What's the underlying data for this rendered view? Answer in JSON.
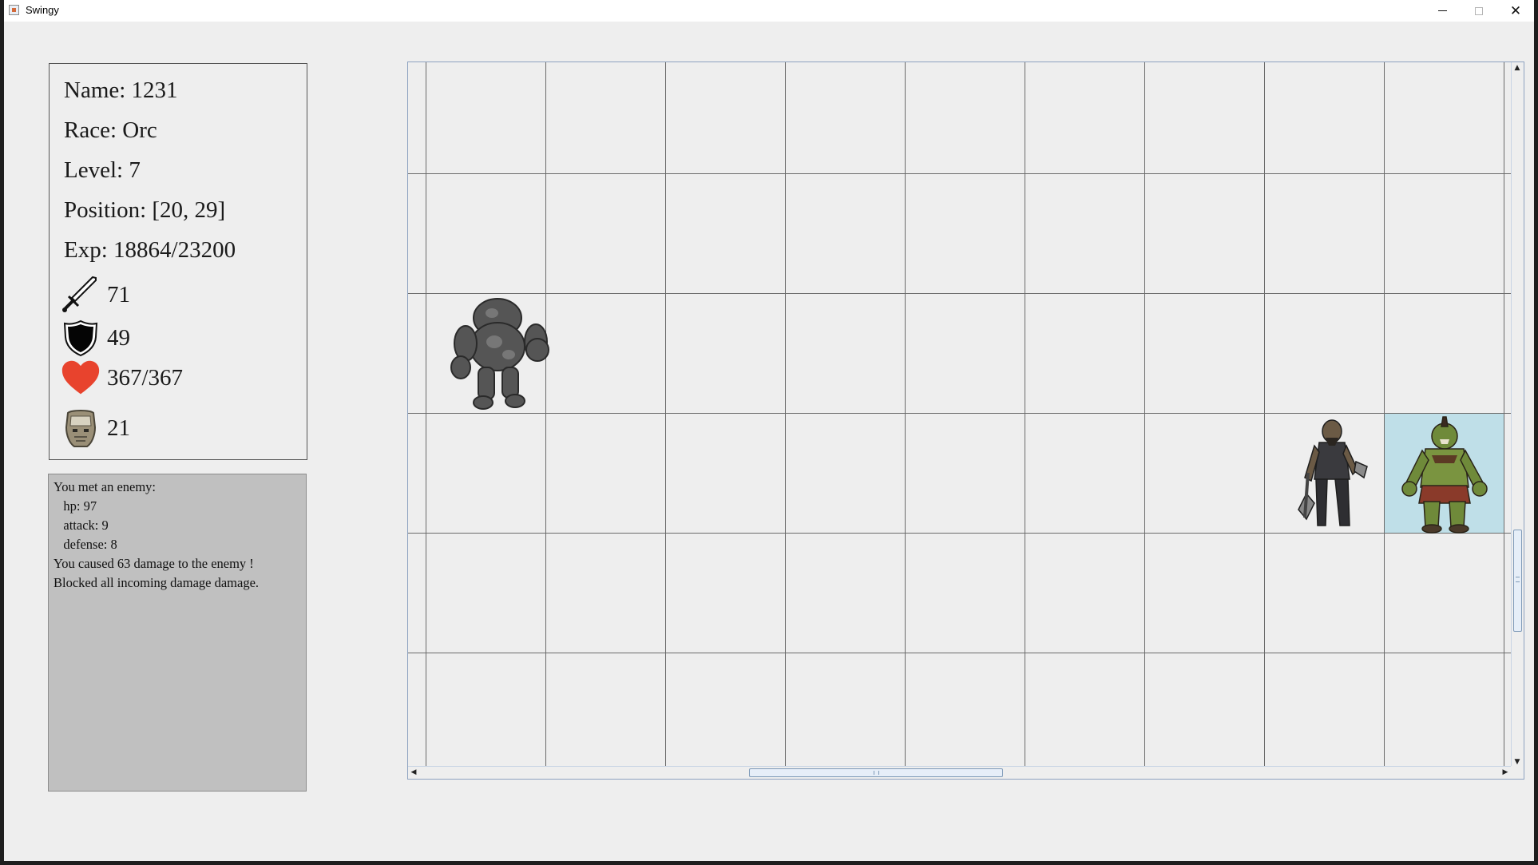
{
  "window": {
    "title": "Swingy"
  },
  "hero": {
    "name_line": "Name: 1231",
    "race_line": "Race: Orc",
    "level_line": "Level: 7",
    "position_line": "Position: [20, 29]",
    "exp_line": "Exp: 18864/23200",
    "attack": "71",
    "defense": "49",
    "hp": "367/367",
    "helm": "21"
  },
  "icons": {
    "attack": "sword-icon",
    "defense": "shield-icon",
    "hp": "heart-icon",
    "helm": "helm-icon"
  },
  "colors": {
    "heart": "#e8432d",
    "log_background": "#c0c0c0",
    "hero_cell": "#bfdfe8"
  },
  "log": {
    "lines": [
      "You met an enemy:",
      "   hp: 97",
      "   attack: 9",
      "   defense: 8",
      "You caused 63 damage to the enemy !",
      "Blocked all incoming damage damage."
    ]
  },
  "map": {
    "sprites": [
      "stone-golem",
      "orc-warrior-enemy",
      "orc-hero"
    ]
  }
}
